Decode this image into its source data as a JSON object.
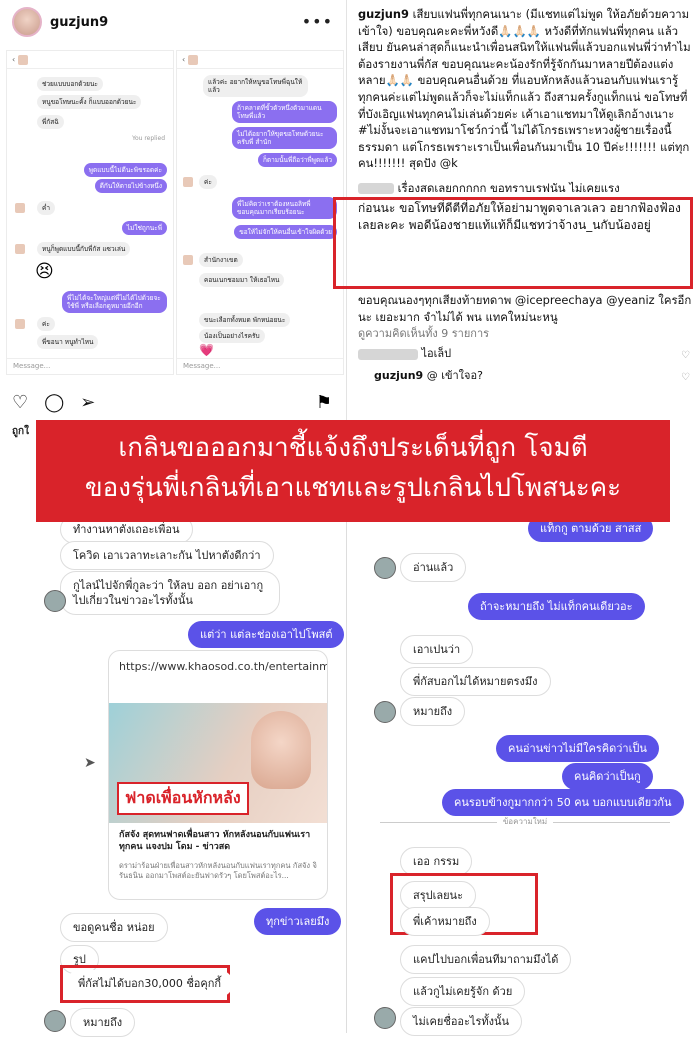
{
  "post": {
    "username": "guzjun9",
    "left_shot": {
      "msgs": [
        "ช่วยแบบบอกด้วยนะ",
        "หนูขอโทษนะคั้ง ก็แบบออกด้วยนะ",
        "พี่กัสฉิ",
        "You replied",
        "พูดแบบนี้ไม่ดีนะพิขรอดค่ะ",
        "ดีกันให้ตายไปข้างหนึ่ง",
        "ค่ำ",
        "ไม่ใช่ถูกนะพี่",
        "หนูก็พูดแบบนี้กับพี่กัส แซวเล่น",
        "พี่ไม่ได้จะใหญ่แต่พี่ไม่ได้ไปด้วยจะใช้พี่ หรือเลือกดูหมายอีกอีก",
        "ค่ะ",
        "พี่ขอนา หนูทำไหน"
      ],
      "input": "Message..."
    },
    "right_shot": {
      "msgs": [
        "แล้วค่ะ อยากให้หนูขอโทษพี่ฉุนให้แล้ว",
        "ถ้าคลาดที่ขั้วตัวหนึ่งตัวมาแดนโทษพี่แล้ว",
        "ไม่ได้อยากให้ขุดขอโทษด้วยนะครับพี่ สำนัก",
        "ก็ตามนั้นพี่ถือว่าพี่พูดแล้ว",
        "ค่ะ",
        "พี่ไม่คิดว่าเราต้องหนอลิทพี่ขอบคุณมากเรียบร้อยนะ",
        "ขอให้ไม่จักให้คนอื่นเข้าใจผิดด้วย",
        "สำนักงาเขต",
        "คอนเนกชอมมา ให้เธอไหน",
        "ขนะเลือกทั้งหมด พักหน่อยนะ",
        "น้องเป็นอย่างไรครับ"
      ],
      "input": "Message..."
    },
    "cut_caption": "ถูกใ"
  },
  "caption": {
    "username": "guzjun9",
    "lines": [
      "เสียบแฟนพี่ทุกคนเนาะ (มีแชทแต่ไม่พูด ให้อภัยด้วยความเข้าใจ) ขอบคุณคะคะพี่หวังดี🙏🏻🙏🏻🙏🏻 หวังดีที่ทักแฟนพี่ทุกคน แล้วเสียบ ยันคนล่าสุดก็แนะนำเพื่อนสนิทให้แฟนพี่แล้วบอกแฟนพี่ว่าทำไมต้องรายงานพี่กัส ขอบคุณนะคะน้องรักที่รู้จักกันมาหลายปีต้องแต่งหลาย🙏🏻🙏🏻",
      "ขอบคุณคนอื่นด้วย ที่แอบหักหลังแล้วนอนกับแฟนเรารู้ทุกคนค่ะแต่ไม่พูดแล้วก็จะไม่แท็กแล้ว ถึงสามครั้งกูแท็กแน่ ขอโทษที่ที่บังเอิญแฟนทุกคนไม่เล่นด้วยค่ะ เค้าเอาแชทมาให้ดูเลิกอ้างเนาะ #ไม่งั้นจะเอาแชทมาโชว์กว่านี้ ไม่ได้โกรธเพราะหวงผู้ชายเรื่องนี้ธรรมดา แต่โกรธเพราะเราเป็นเพื่อนกันมาเป็น 10 ปีค่ะ!!!!!!! แต่ทุกคน!!!!!!! สุดปัง @k",
      "เรื่องสดเลยกกกกก ขอทราบเรฟนัน ไม่เคยแรง",
      "ก่อนนะ ขอโทษที่ดีตีที่อภัยให้อย่ามาพูดจาเลวเลว อยากฟ้องฟ้องเลยละคะ พอดีน้องชายแท้แท้ก็มีแชทว่าจ้างน_นกับน้องอยู่",
      "ขอบคุณนองๆทุกเสียงท้ายทดาพ @icepreechaya @yeaniz ใครอีกนะ เยอะมาก จำไม่ได้ พน แทคใหม่นะหนู"
    ],
    "view_comments": "ดูความคิดเห็นทั้ง 9 รายการ",
    "comment1": "ไอเล็ป",
    "comment2_user": "guzjun9",
    "comment2": "@ เข้าใจอ?"
  },
  "banner": {
    "line1": "เกลินขอออกมาชี้แจ้งถึงประเด็นที่ถูก โจมตี",
    "line2": "ของรุ่นพี่เกลินที่เอาแชทและรูปเกลินไปโพสนะคะ"
  },
  "left_chat": {
    "m1": "ทำงานหาตังเถอะเพื่อน",
    "m2": "โควิด เอาเวลาทะเลาะกัน ไปหาตังดีกว่า",
    "m3": "กูไลน์ไปจักพี่กูละว่า ให้ลบ ออก อย่าเอากูไปเกี่ยวในข่าวอะไรทั้งนั้น",
    "m4": "แต่ว่า แต่ละช่องเอาไปโพสต์",
    "card_url": "https://www.khaosod.co.th/entertainment/news_6494985",
    "card_headline": "ฟาดเพื่อนหักหลัง",
    "card_title": "กัสจัง สุดทนฟาดเพื่อนสาว หักหลังนอนกับแฟนเราทุกคน แจงปม โดม - ข่าวสด",
    "card_desc": "ดราม่าร้อนฝ่ายเพื่อนสาวหักหลังนอนกับแฟนเราทุกคน กัสจัง จิรันธนิน ออกมาโพสต์อะยันฟาดรัวๆ โดยโพสต์อะไร...",
    "m5": "ทุกข่าวเลยมึง",
    "m6": "ขอดูคนชื่อ หน่อย",
    "m7": "รูป",
    "m8": "พี่กัสไม่ได้บอก30,000 ชื่อคุกกี้",
    "m9": "หมายถึง"
  },
  "right_chat": {
    "r1": "แท็กกู ตามด้วย สาสส",
    "r2": "อ่านแล้ว",
    "r3": "ถ้าจะหมายถึง ไม่แท็กคนเดียวอะ",
    "r4": "เอาเปนว่า",
    "r5": "พี่กัสบอกไม่ได้หมายตรงมึง",
    "r6": "หมายถึง",
    "r7": "คนอ่านข่าวไม่มีใครคิดว่าเป็น",
    "r8": "คนคิดว่าเป็นกู",
    "r9": "คนรอบข้างกูมากกว่า 50 คน บอกแบบเดียวกัน",
    "divider": "ข้อความใหม่",
    "r10": "เออ กรรม",
    "r11": "สรุปเลยนะ",
    "r12": "พี่เค้าหมายถึง",
    "r13": "แคปไปบอกเพื่อนทีมาถามมึงได้",
    "r14": "แล้วกูไม่เคยรู้จัก ด้วย",
    "r15": "ไม่เคยชื่ออะไรทั้งนั้น"
  }
}
